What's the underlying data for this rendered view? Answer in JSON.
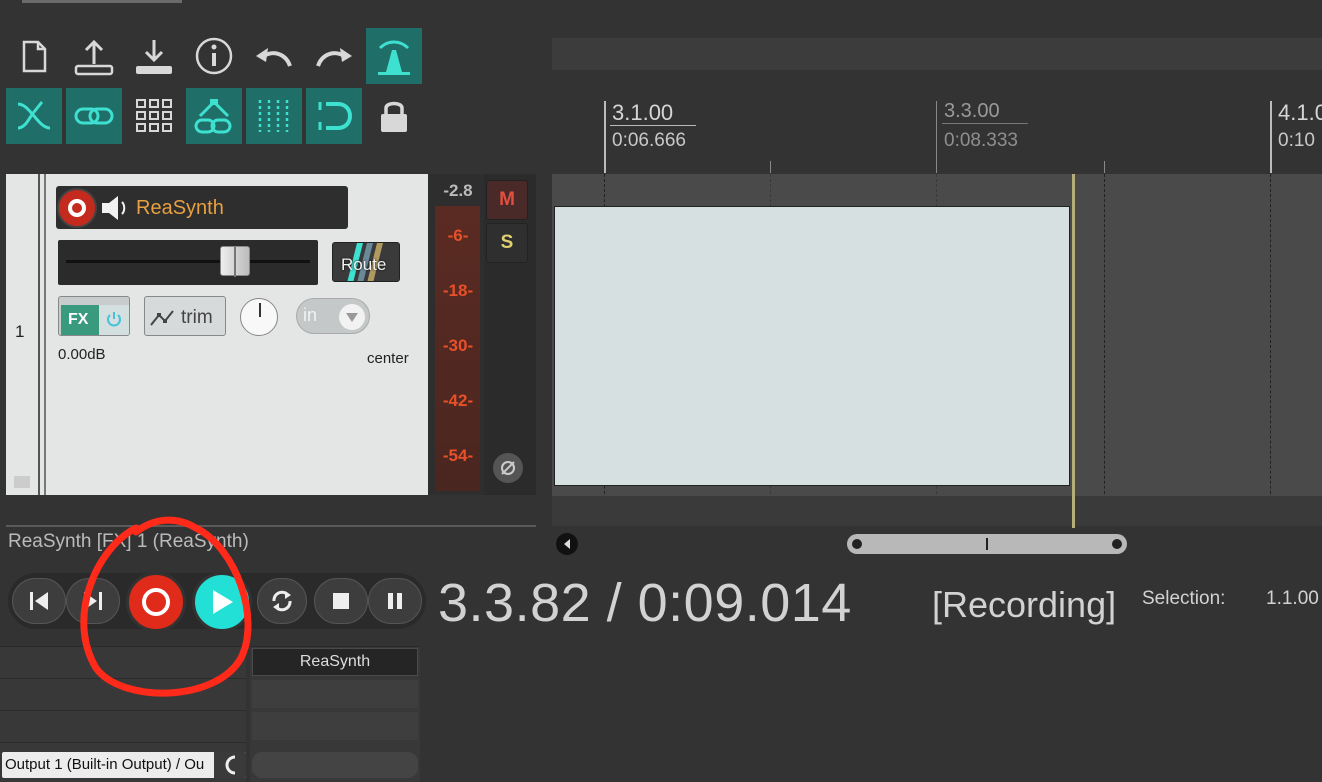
{
  "toolbar": {
    "row1": [
      {
        "icon": "new-file-icon"
      },
      {
        "icon": "upload-icon"
      },
      {
        "icon": "download-icon"
      },
      {
        "icon": "info-icon"
      },
      {
        "icon": "undo-icon"
      },
      {
        "icon": "redo-icon"
      },
      {
        "icon": "metronome-icon",
        "active": true
      }
    ],
    "row2": [
      {
        "icon": "crossfade-icon",
        "active": true
      },
      {
        "icon": "link-icon",
        "active": true
      },
      {
        "icon": "grid-icon",
        "active": false
      },
      {
        "icon": "group-link-icon",
        "active": true
      },
      {
        "icon": "snap-grid-icon",
        "active": true
      },
      {
        "icon": "loop-snap-icon",
        "active": true
      },
      {
        "icon": "lock-icon",
        "active": false
      }
    ]
  },
  "ruler": {
    "markers": [
      {
        "beat": "3.1.00",
        "time": "0:06.666"
      },
      {
        "beat": "3.3.00",
        "time": "0:08.333"
      },
      {
        "beat": "4.1.0",
        "time": "0:10"
      }
    ]
  },
  "track": {
    "number": "1",
    "name": "ReaSynth",
    "route_label": "Route",
    "fx_label": "FX",
    "trim_label": "trim",
    "input_label": "in",
    "volume": "0.00dB",
    "pan": "center",
    "mute_label": "M",
    "solo_label": "S",
    "meter_peak": "-2.8",
    "meter_scale": [
      "-6-",
      "-18-",
      "-30-",
      "-42-",
      "-54-"
    ]
  },
  "fx_chain_status": "ReaSynth [FX] 1 (ReaSynth)",
  "transport": {
    "position": "3.3.82 / 0:09.014",
    "state": "[Recording]",
    "selection_label": "Selection:",
    "selection_value": "1.1.00"
  },
  "mixer": {
    "track_name": "ReaSynth",
    "output_label": "Output 1 (Built-in Output) / Ou"
  },
  "colors": {
    "accent_teal": "#1f6e68",
    "teal_bright": "#3ee0d0",
    "record_red": "#e02a1a",
    "track_name_orange": "#e8a040",
    "annotation_red": "#ff2a1a"
  }
}
